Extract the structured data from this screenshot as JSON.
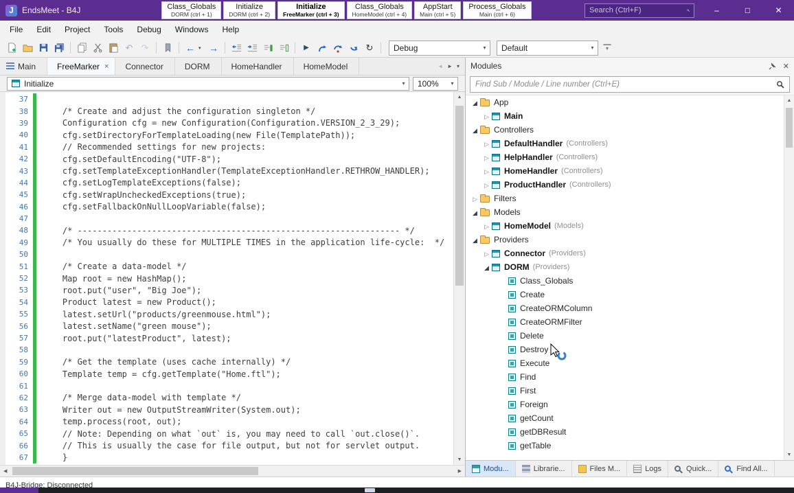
{
  "icons": {
    "minimize": "–",
    "maximize": "□",
    "close": "✕",
    "caret_down": "▾",
    "scroll_up": "▲",
    "scroll_down": "▼",
    "scroll_left": "◀",
    "scroll_right": "▶",
    "tab_prev": "◄",
    "tab_next": "►",
    "back": "←",
    "forward": "→",
    "undo": "↶",
    "redo": "↷",
    "run": "▶",
    "restart": "↻"
  },
  "titlebar": {
    "logo_letter": "J",
    "title": "EndsMeet - B4J",
    "search_placeholder": "Search (Ctrl+F)",
    "tabs": [
      {
        "title": "Class_Globals",
        "subtitle": "DORM (ctrl + 1)",
        "active": false
      },
      {
        "title": "Initialize",
        "subtitle": "DORM (ctrl + 2)",
        "active": false
      },
      {
        "title": "Initialize",
        "subtitle": "FreeMarker (ctrl + 3)",
        "active": true
      },
      {
        "title": "Class_Globals",
        "subtitle": "HomeModel (ctrl + 4)",
        "active": false
      },
      {
        "title": "AppStart",
        "subtitle": "Main (ctrl + 5)",
        "active": false
      },
      {
        "title": "Process_Globals",
        "subtitle": "Main (ctrl + 6)",
        "active": false
      }
    ]
  },
  "menubar": {
    "items": [
      "File",
      "Edit",
      "Project",
      "Tools",
      "Debug",
      "Windows",
      "Help"
    ]
  },
  "toolbar": {
    "debug_mode": "Debug",
    "build_config": "Default"
  },
  "editor": {
    "tabs": [
      {
        "label": "Main",
        "icon": "form-icon"
      },
      {
        "label": "FreeMarker",
        "icon": "module-icon",
        "active": true,
        "close": "×"
      },
      {
        "label": "Connector",
        "icon": "module-icon"
      },
      {
        "label": "DORM",
        "icon": "module-icon"
      },
      {
        "label": "HomeHandler",
        "icon": "module-icon"
      },
      {
        "label": "HomeModel",
        "icon": "module-icon"
      }
    ],
    "sub_selector": "Initialize",
    "zoom": "100%",
    "lines": [
      {
        "num": 37,
        "text": "",
        "green": true
      },
      {
        "num": 38,
        "text": "    /* Create and adjust the configuration singleton */",
        "green": true
      },
      {
        "num": 39,
        "text": "    Configuration cfg = new Configuration(Configuration.VERSION_2_3_29);",
        "green": true
      },
      {
        "num": 40,
        "text": "    cfg.setDirectoryForTemplateLoading(new File(TemplatePath));",
        "green": true
      },
      {
        "num": 41,
        "text": "    // Recommended settings for new projects:",
        "green": true
      },
      {
        "num": 42,
        "text": "    cfg.setDefaultEncoding(\"UTF-8\");",
        "green": true
      },
      {
        "num": 43,
        "text": "    cfg.setTemplateExceptionHandler(TemplateExceptionHandler.RETHROW_HANDLER);",
        "green": true
      },
      {
        "num": 44,
        "text": "    cfg.setLogTemplateExceptions(false);",
        "green": true
      },
      {
        "num": 45,
        "text": "    cfg.setWrapUncheckedExceptions(true);",
        "green": true
      },
      {
        "num": 46,
        "text": "    cfg.setFallbackOnNullLoopVariable(false);",
        "green": true
      },
      {
        "num": 47,
        "text": "",
        "green": true
      },
      {
        "num": 48,
        "text": "    /* ----------------------------------------------------------------- */",
        "green": true
      },
      {
        "num": 49,
        "text": "    /* You usually do these for MULTIPLE TIMES in the application life-cycle:  */",
        "green": true
      },
      {
        "num": 50,
        "text": "",
        "green": true
      },
      {
        "num": 51,
        "text": "    /* Create a data-model */",
        "green": true
      },
      {
        "num": 52,
        "text": "    Map root = new HashMap();",
        "green": true
      },
      {
        "num": 53,
        "text": "    root.put(\"user\", \"Big Joe\");",
        "green": true
      },
      {
        "num": 54,
        "text": "    Product latest = new Product();",
        "green": true
      },
      {
        "num": 55,
        "text": "    latest.setUrl(\"products/greenmouse.html\");",
        "green": true
      },
      {
        "num": 56,
        "text": "    latest.setName(\"green mouse\");",
        "green": true
      },
      {
        "num": 57,
        "text": "    root.put(\"latestProduct\", latest);",
        "green": true
      },
      {
        "num": 58,
        "text": "",
        "green": true
      },
      {
        "num": 59,
        "text": "    /* Get the template (uses cache internally) */",
        "green": true
      },
      {
        "num": 60,
        "text": "    Template temp = cfg.getTemplate(\"Home.ftl\");",
        "green": true
      },
      {
        "num": 61,
        "text": "",
        "green": true
      },
      {
        "num": 62,
        "text": "    /* Merge data-model with template */",
        "green": true
      },
      {
        "num": 63,
        "text": "    Writer out = new OutputStreamWriter(System.out);",
        "green": true
      },
      {
        "num": 64,
        "text": "    temp.process(root, out);",
        "green": true
      },
      {
        "num": 65,
        "text": "    // Note: Depending on what `out` is, you may need to call `out.close()`.",
        "green": true
      },
      {
        "num": 66,
        "text": "    // This is usually the case for file output, but not for servlet output.",
        "green": true
      },
      {
        "num": 67,
        "text": "    }",
        "green": true
      }
    ]
  },
  "modules": {
    "title": "Modules",
    "search_placeholder": "Find Sub / Module / Line number (Ctrl+E)",
    "tree": [
      {
        "label": "App",
        "dclass": "d0",
        "arrow": "exp",
        "icon": "folder"
      },
      {
        "label": "Main",
        "dclass": "d1",
        "arrow": "col",
        "icon": "module",
        "bold": true
      },
      {
        "label": "Controllers",
        "dclass": "d0",
        "arrow": "exp",
        "icon": "folder"
      },
      {
        "label": "DefaultHandler",
        "suffix": "(Controllers)",
        "dclass": "d1",
        "arrow": "col",
        "icon": "module",
        "bold": true
      },
      {
        "label": "HelpHandler",
        "suffix": "(Controllers)",
        "dclass": "d1",
        "arrow": "col",
        "icon": "module",
        "bold": true
      },
      {
        "label": "HomeHandler",
        "suffix": "(Controllers)",
        "dclass": "d1",
        "arrow": "col",
        "icon": "module",
        "bold": true
      },
      {
        "label": "ProductHandler",
        "suffix": "(Controllers)",
        "dclass": "d1",
        "arrow": "col",
        "icon": "module",
        "bold": true
      },
      {
        "label": "Filters",
        "dclass": "d0",
        "arrow": "col",
        "icon": "folder"
      },
      {
        "label": "Models",
        "dclass": "d0",
        "arrow": "exp",
        "icon": "folder"
      },
      {
        "label": "HomeModel",
        "suffix": "(Models)",
        "dclass": "d1",
        "arrow": "col",
        "icon": "module",
        "bold": true
      },
      {
        "label": "Providers",
        "dclass": "d0",
        "arrow": "exp",
        "icon": "folder"
      },
      {
        "label": "Connector",
        "suffix": "(Providers)",
        "dclass": "d1",
        "arrow": "col",
        "icon": "module",
        "bold": true
      },
      {
        "label": "DORM",
        "suffix": "(Providers)",
        "dclass": "d1",
        "arrow": "exp",
        "icon": "module",
        "bold": true
      },
      {
        "label": "Class_Globals",
        "dclass": "d2",
        "arrow": "none",
        "icon": "sub"
      },
      {
        "label": "Create",
        "dclass": "d2",
        "arrow": "none",
        "icon": "sub"
      },
      {
        "label": "CreateORMColumn",
        "dclass": "d2",
        "arrow": "none",
        "icon": "sub"
      },
      {
        "label": "CreateORMFilter",
        "dclass": "d2",
        "arrow": "none",
        "icon": "sub"
      },
      {
        "label": "Delete",
        "dclass": "d2",
        "arrow": "none",
        "icon": "sub"
      },
      {
        "label": "Destroy",
        "dclass": "d2",
        "arrow": "none",
        "icon": "sub"
      },
      {
        "label": "Execute",
        "dclass": "d2",
        "arrow": "none",
        "icon": "sub"
      },
      {
        "label": "Find",
        "dclass": "d2",
        "arrow": "none",
        "icon": "sub"
      },
      {
        "label": "First",
        "dclass": "d2",
        "arrow": "none",
        "icon": "sub"
      },
      {
        "label": "Foreign",
        "dclass": "d2",
        "arrow": "none",
        "icon": "sub"
      },
      {
        "label": "getCount",
        "dclass": "d2",
        "arrow": "none",
        "icon": "sub"
      },
      {
        "label": "getDBResult",
        "dclass": "d2",
        "arrow": "none",
        "icon": "sub"
      },
      {
        "label": "getTable",
        "dclass": "d2",
        "arrow": "none",
        "icon": "sub"
      }
    ],
    "bottom_tabs": [
      {
        "label": "Modu...",
        "icon": "modules",
        "active": true
      },
      {
        "label": "Librarie...",
        "icon": "libraries"
      },
      {
        "label": "Files M...",
        "icon": "files"
      },
      {
        "label": "Logs",
        "icon": "logs"
      },
      {
        "label": "Quick...",
        "icon": "quick"
      },
      {
        "label": "Find All...",
        "icon": "findall"
      }
    ]
  },
  "status": {
    "text": "B4J-Bridge: Disconnected"
  }
}
